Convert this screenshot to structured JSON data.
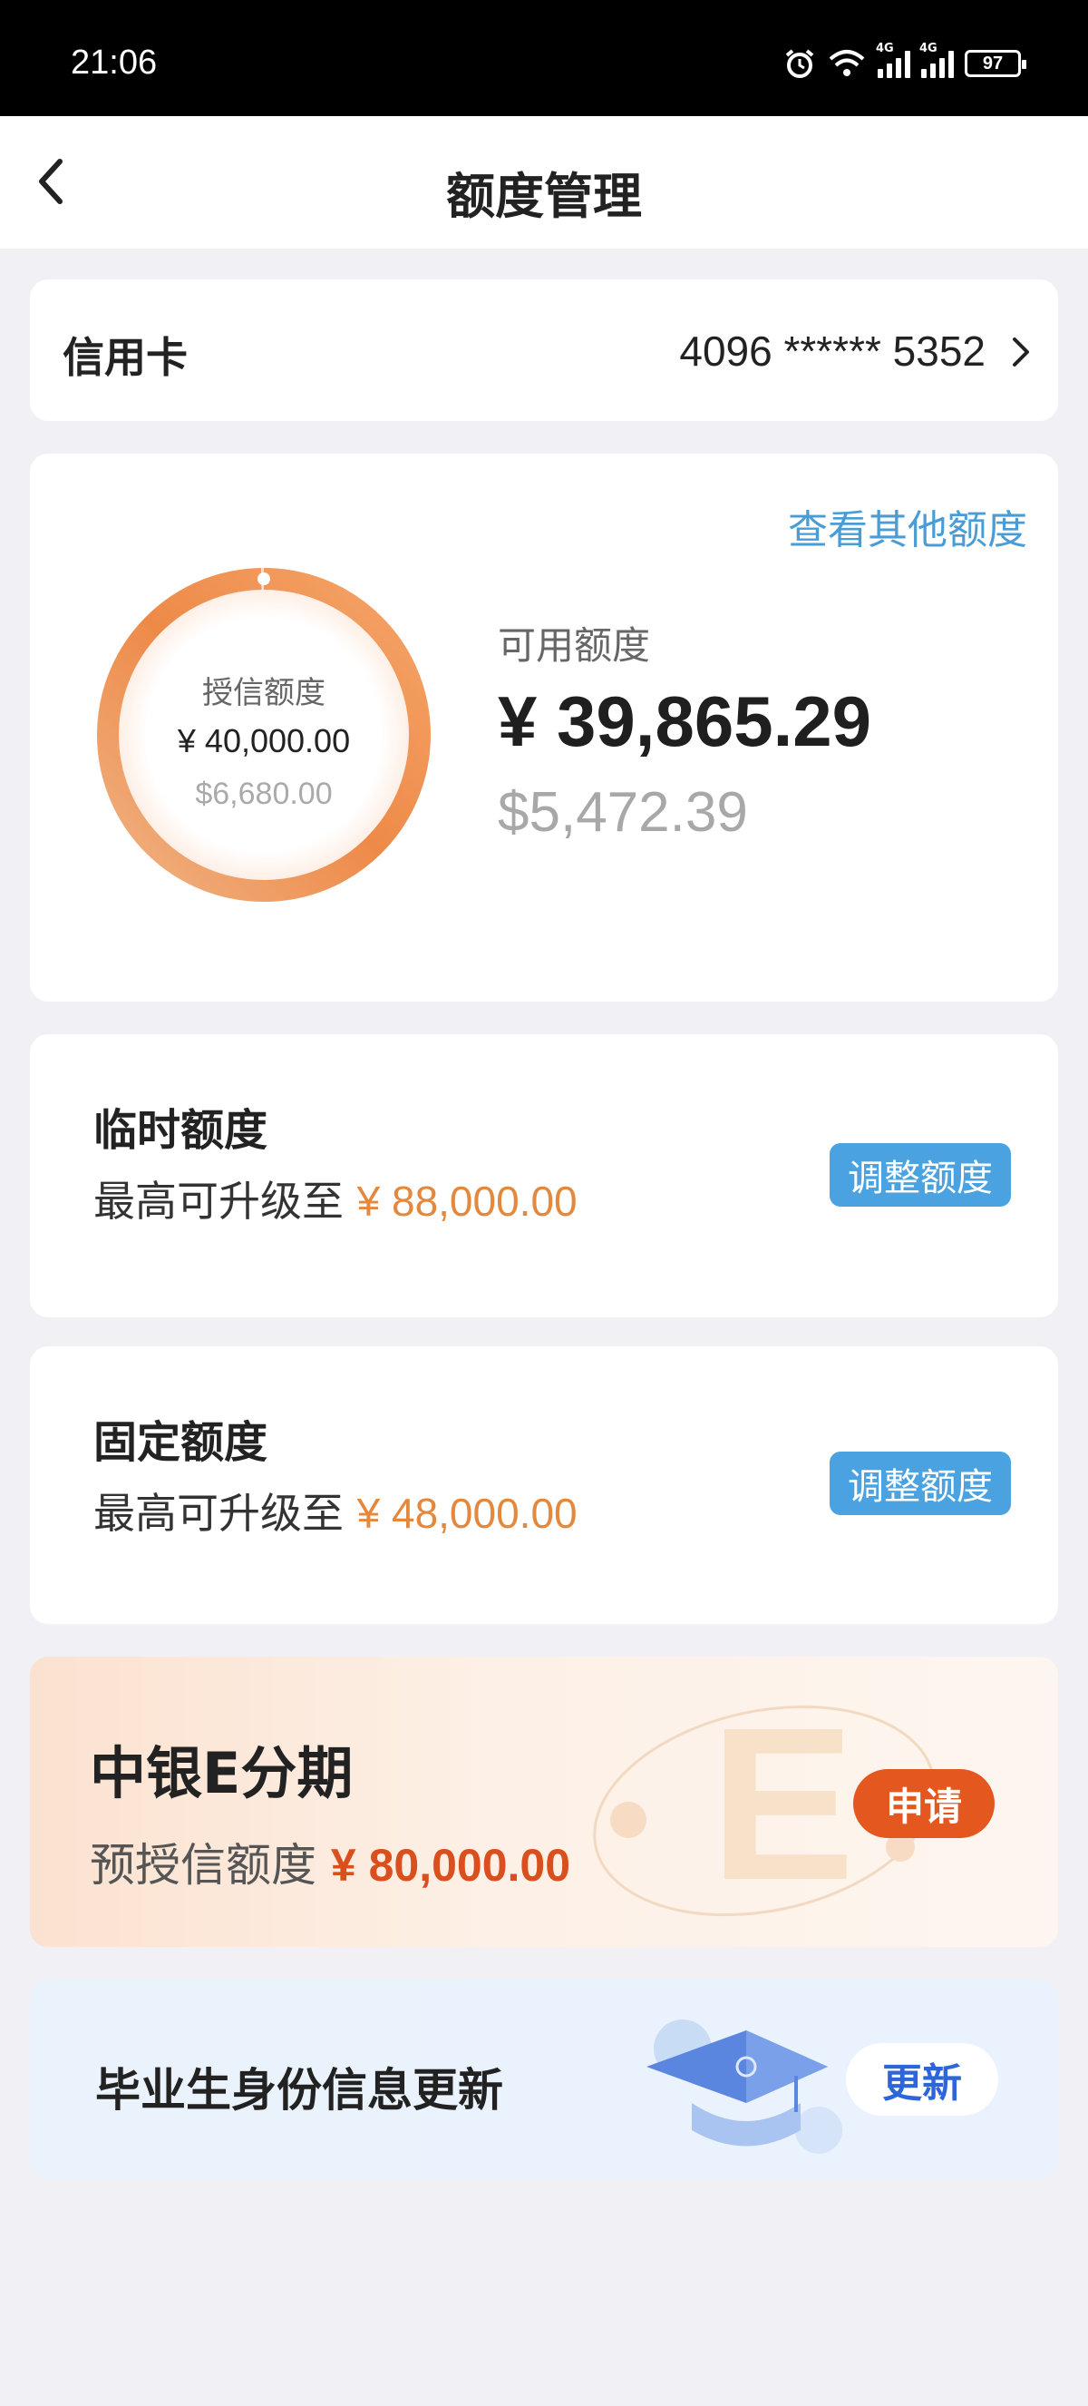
{
  "status_bar": {
    "time": "21:06",
    "network_1": "4G",
    "network_2": "4G",
    "battery": "97",
    "icons": [
      "alarm-icon",
      "wifi-icon",
      "signal-icon",
      "signal-icon",
      "battery-icon"
    ]
  },
  "nav": {
    "title": "额度管理",
    "back_icon": "chevron-left-icon"
  },
  "card_selector": {
    "label": "信用卡",
    "number": "4096 ****** 5352",
    "chevron_icon": "chevron-right-icon"
  },
  "limit_summary": {
    "other_limits_link": "查看其他额度",
    "credit_limit_label": "授信额度",
    "credit_limit_cny": "¥ 40,000.00",
    "credit_limit_usd": "$6,680.00",
    "available_label": "可用额度",
    "available_cny": "¥ 39,865.29",
    "available_usd": "$5,472.39",
    "available_ratio": 0.997
  },
  "temp_limit": {
    "title": "临时额度",
    "prefix": "最高可升级至",
    "amount": "¥ 88,000.00",
    "button": "调整额度"
  },
  "fixed_limit": {
    "title": "固定额度",
    "prefix": "最高可升级至",
    "amount": "¥ 48,000.00",
    "button": "调整额度"
  },
  "e_installment": {
    "title": "中银E分期",
    "prefix": "预授信额度",
    "amount": "¥ 80,000.00",
    "button": "申请"
  },
  "graduate": {
    "title": "毕业生身份信息更新",
    "button": "更新",
    "icon": "graduation-cap-icon"
  },
  "colors": {
    "accent_blue": "#4aa3e0",
    "ring_orange": "#ee8a48",
    "amount_orange": "#e4883e",
    "apply_red": "#e4571e",
    "update_blue": "#2c66d8"
  }
}
